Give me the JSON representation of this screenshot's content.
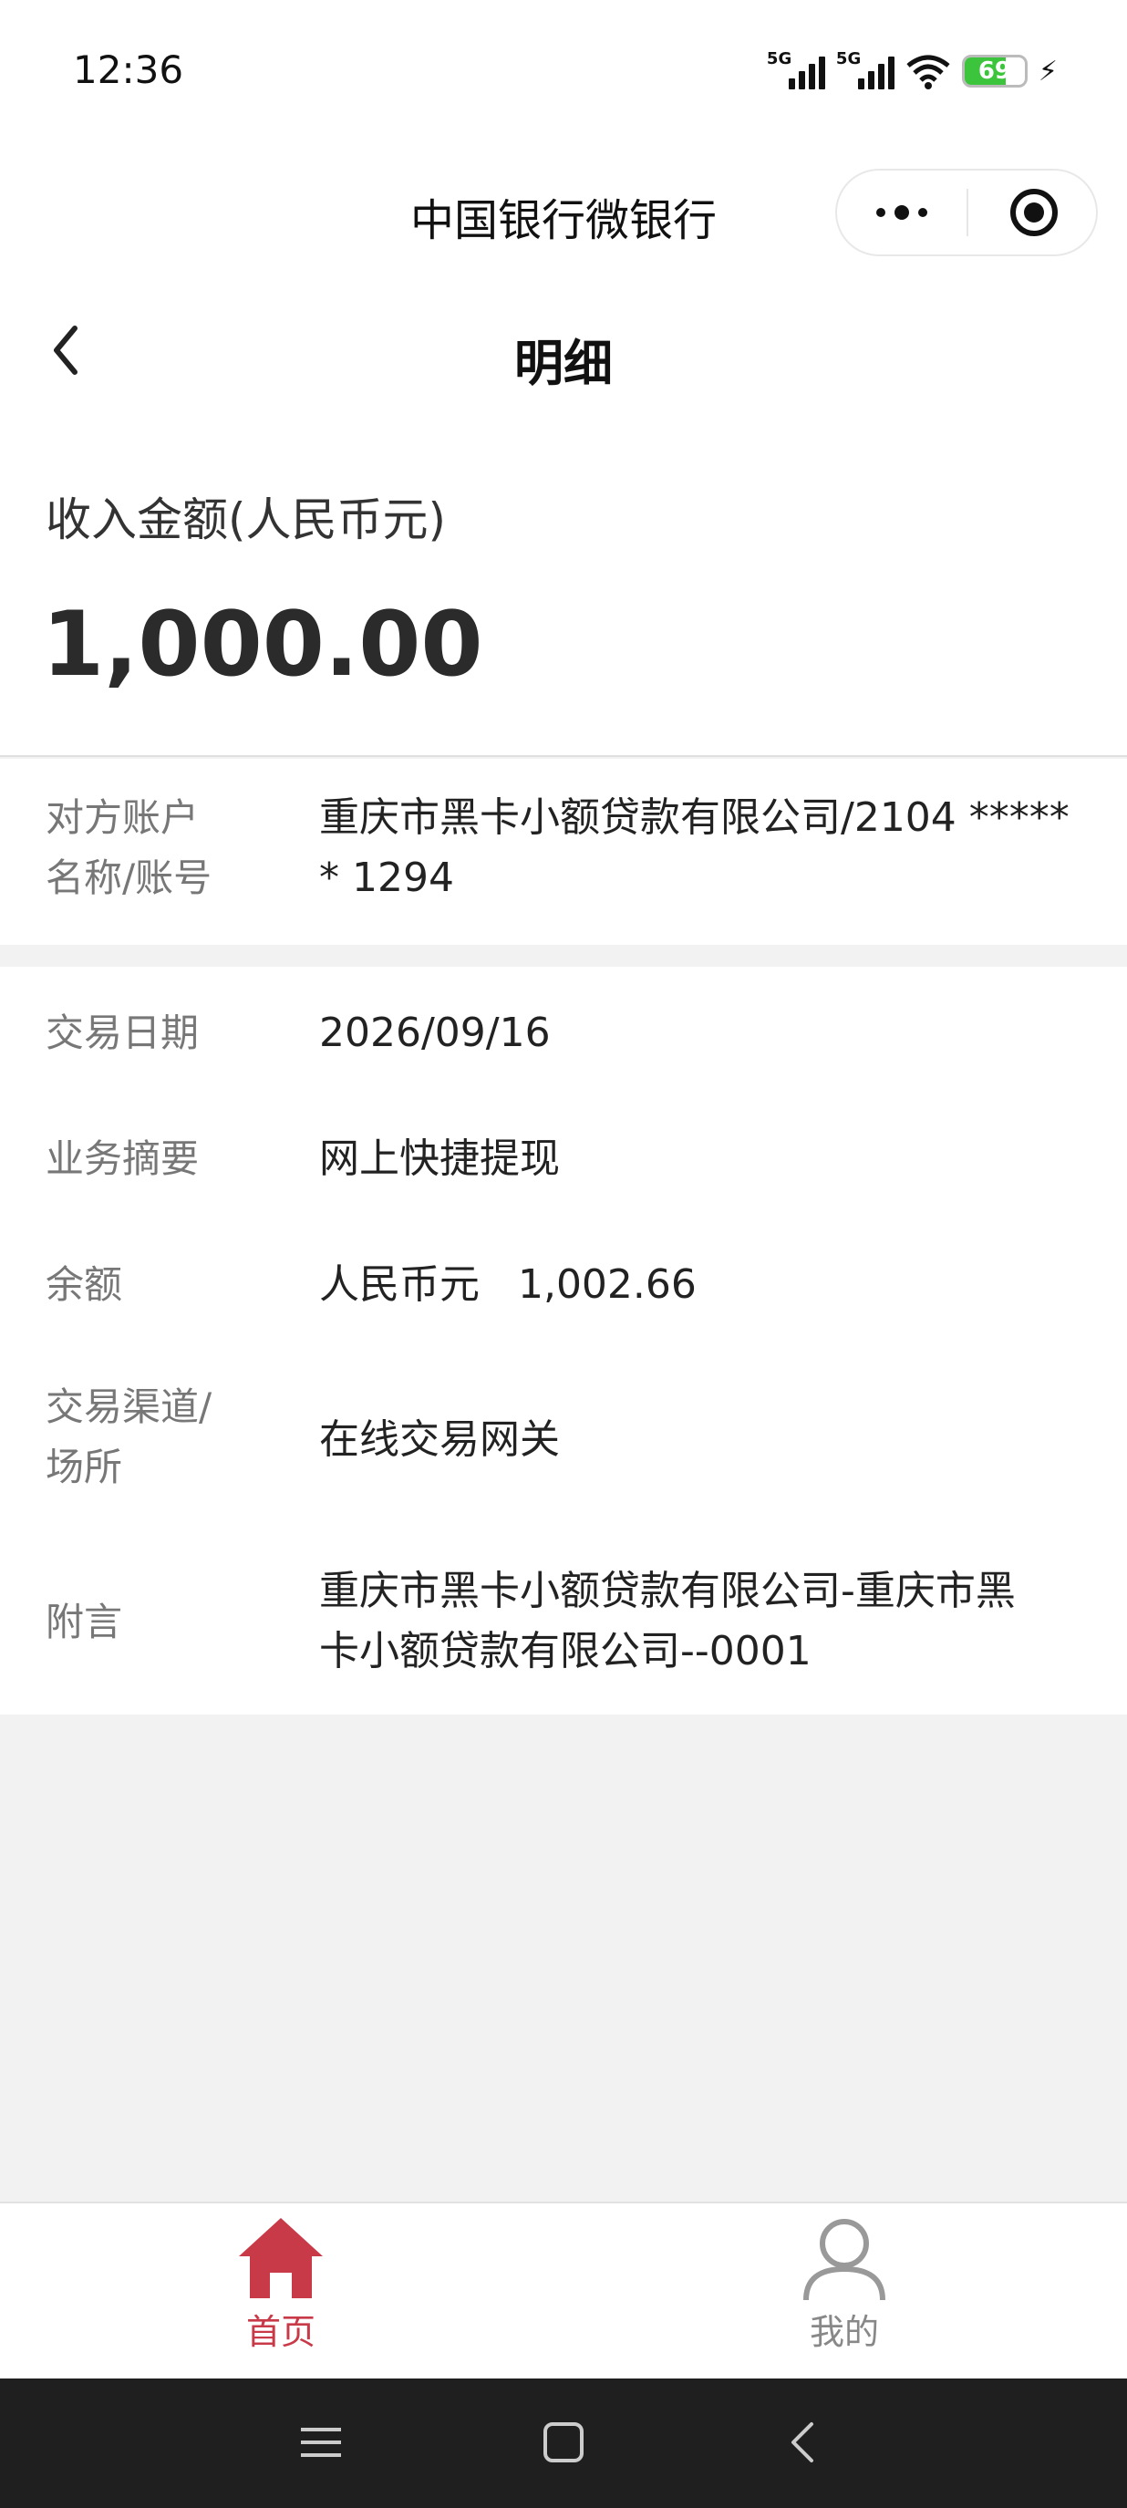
{
  "status_bar": {
    "time": "12:36",
    "network_1": "5G",
    "network_2": "5G",
    "battery_level": 69,
    "battery_text": "69",
    "battery_color": "#3cc53c",
    "icons": [
      "signal-icon",
      "signal-icon",
      "wifi-icon",
      "battery-icon",
      "charging-icon"
    ]
  },
  "title_bar": {
    "title": "中国银行微银行",
    "icons": [
      "more-icon",
      "close-target-icon"
    ]
  },
  "header": {
    "title": "明细",
    "back_icon": "chevron-left-icon"
  },
  "amount": {
    "label": "收入金额(人民币元)",
    "value": "1,000.00"
  },
  "counterparty": {
    "label_line1": "对方账户",
    "label_line2": "名称/账号",
    "value_line1": "重庆市黑卡小额贷款有限公司/2104 *****",
    "value_line2": "* 1294"
  },
  "details": [
    {
      "label": "交易日期",
      "value": "2026/09/16"
    },
    {
      "label": "业务摘要",
      "value": "网上快捷提现"
    },
    {
      "label": "余额",
      "value": "人民币元   1,002.66"
    },
    {
      "label_line1": "交易渠道/",
      "label_line2": "场所",
      "value": "在线交易网关"
    },
    {
      "label": "附言",
      "value_line1": "重庆市黑卡小额贷款有限公司-重庆市黑",
      "value_line2": "卡小额贷款有限公司--0001"
    }
  ],
  "tab_bar": {
    "active_color": "#c93a48",
    "items": [
      {
        "label": "首页",
        "icon": "home-icon",
        "active": true
      },
      {
        "label": "我的",
        "icon": "user-icon",
        "active": false
      }
    ]
  },
  "nav_bar": {
    "icons": [
      "menu-icon",
      "home-square-icon",
      "back-icon"
    ]
  }
}
